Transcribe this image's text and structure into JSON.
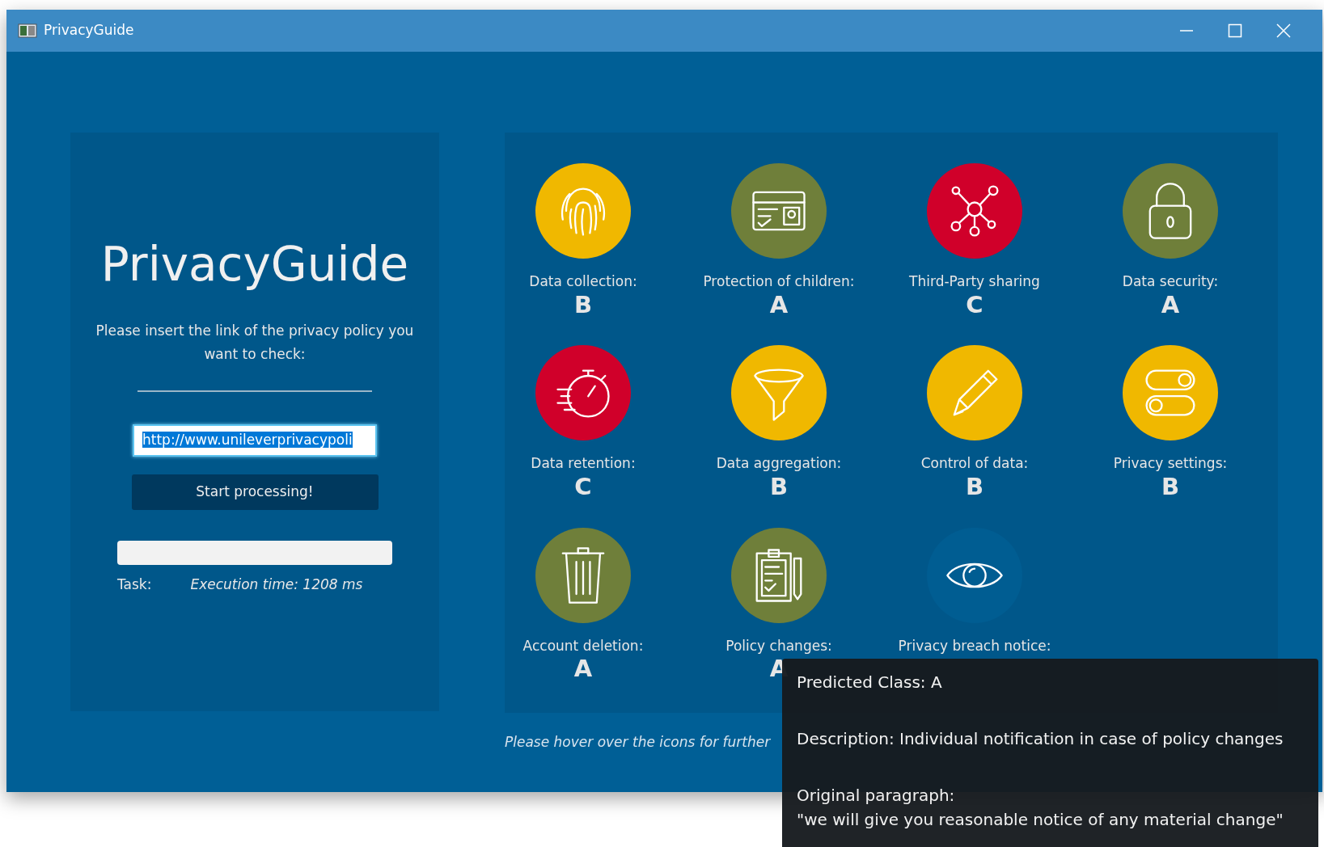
{
  "window": {
    "title": "PrivacyGuide"
  },
  "left_panel": {
    "app_title": "PrivacyGuide",
    "instruction": "Please insert the link of the privacy policy you want to check:",
    "url_field": {
      "value": "http://www.unileverprivacypoli"
    },
    "start_button": "Start processing!",
    "task_label": "Task:",
    "task_status": "Execution time: 1208 ms"
  },
  "categories": [
    {
      "label": "Data collection:",
      "grade": "B",
      "color": "#f0b800"
    },
    {
      "label": "Protection of children:",
      "grade": "A",
      "color": "#6f7f3a"
    },
    {
      "label": "Third-Party sharing",
      "grade": "C",
      "color": "#d0002a"
    },
    {
      "label": "Data security:",
      "grade": "A",
      "color": "#6f7f3a"
    },
    {
      "label": "Data retention:",
      "grade": "C",
      "color": "#d0002a"
    },
    {
      "label": "Data aggregation:",
      "grade": "B",
      "color": "#f0b800"
    },
    {
      "label": "Control of data:",
      "grade": "B",
      "color": "#f0b800"
    },
    {
      "label": "Privacy settings:",
      "grade": "B",
      "color": "#f0b800"
    },
    {
      "label": "Account deletion:",
      "grade": "A",
      "color": "#6f7f3a"
    },
    {
      "label": "Policy changes:",
      "grade": "A",
      "color": "#6f7f3a"
    },
    {
      "label": "Privacy breach notice:",
      "color": "#005d92"
    }
  ],
  "hint": "Please hover over the icons for further",
  "tooltip": {
    "predicted": "Predicted Class: A",
    "description": "Description: Individual notification in case of policy changes",
    "paragraph_label": "Original paragraph:",
    "paragraph": "\"we will give you reasonable notice of any material change\""
  }
}
